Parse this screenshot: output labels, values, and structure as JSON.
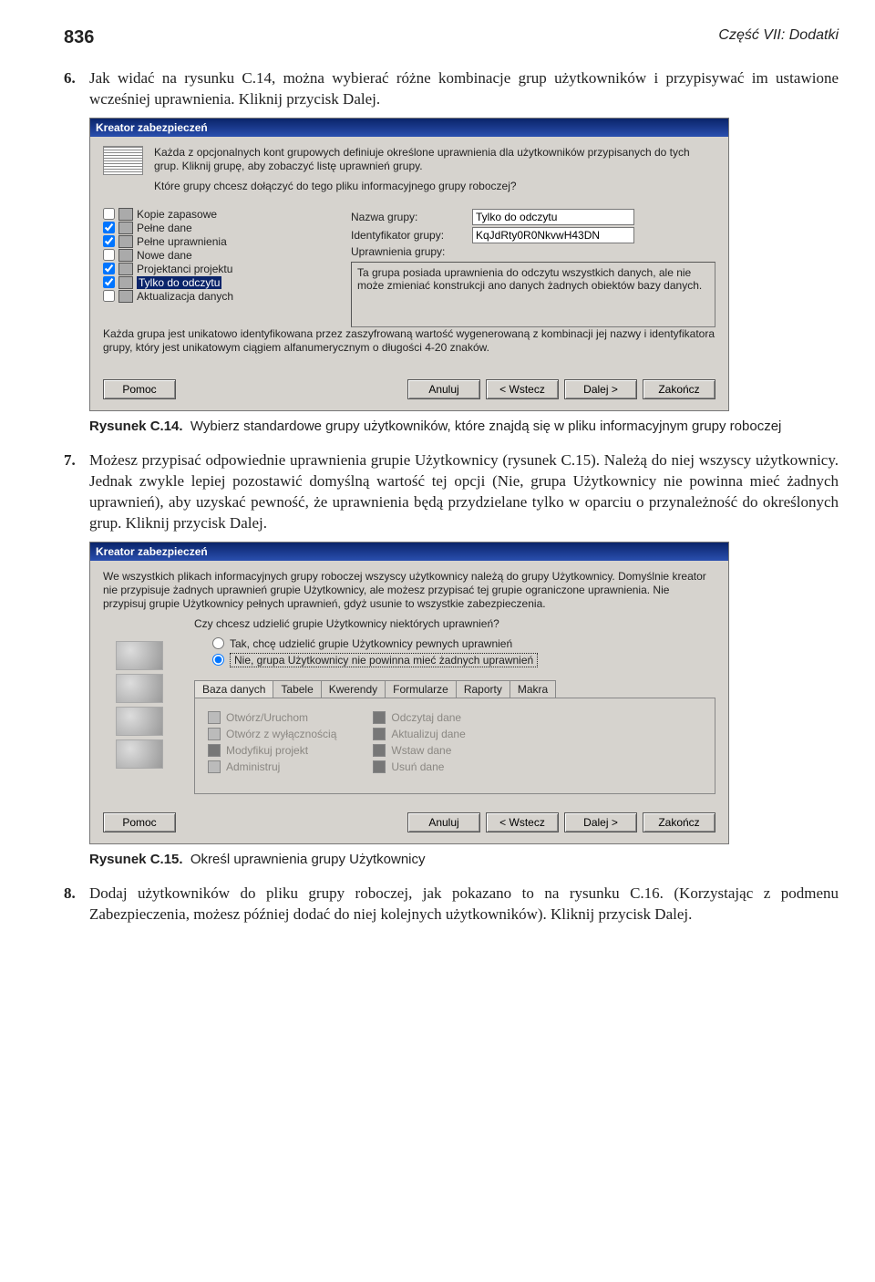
{
  "header": {
    "page_num": "836",
    "section": "Część VII: Dodatki"
  },
  "para6": {
    "num": "6.",
    "text": "Jak widać na rysunku C.14, można wybierać różne kombinacje grup użytkowników i przypisywać im ustawione wcześniej uprawnienia. Kliknij przycisk Dalej."
  },
  "dialog1": {
    "title": "Kreator zabezpieczeń",
    "intro1": "Każda z opcjonalnych kont grupowych definiuje określone uprawnienia dla użytkowników przypisanych do tych grup. Kliknij grupę, aby zobaczyć listę uprawnień grupy.",
    "intro2": "Które grupy chcesz dołączyć do tego pliku informacyjnego grupy roboczej?",
    "groups": [
      {
        "label": "Kopie zapasowe",
        "checked": false
      },
      {
        "label": "Pełne dane",
        "checked": true
      },
      {
        "label": "Pełne uprawnienia",
        "checked": true
      },
      {
        "label": "Nowe dane",
        "checked": false
      },
      {
        "label": "Projektanci projektu",
        "checked": true
      },
      {
        "label": "Tylko do odczytu",
        "checked": true,
        "selected": true
      },
      {
        "label": "Aktualizacja danych",
        "checked": false
      }
    ],
    "field_labels": {
      "name": "Nazwa grupy:",
      "id": "Identyfikator grupy:",
      "perm": "Uprawnienia grupy:"
    },
    "field_values": {
      "name": "Tylko do odczytu",
      "id": "KqJdRty0R0NkvwH43DN"
    },
    "perm_desc": "Ta grupa posiada uprawnienia do odczytu wszystkich danych, ale nie może zmieniać konstrukcji ano danych żadnych obiektów bazy danych.",
    "note": "Każda grupa jest unikatowo identyfikowana przez zaszyfrowaną wartość wygenerowaną z kombinacji jej nazwy i identyfikatora grupy, który jest unikatowym ciągiem alfanumerycznym o długości 4-20 znaków.",
    "buttons": {
      "help": "Pomoc",
      "cancel": "Anuluj",
      "back": "< Wstecz",
      "next": "Dalej >",
      "finish": "Zakończ"
    }
  },
  "caption1": {
    "label": "Rysunek C.14.",
    "text": "Wybierz standardowe grupy użytkowników, które znajdą się w pliku informacyjnym grupy roboczej"
  },
  "para7": {
    "num": "7.",
    "text": "Możesz przypisać odpowiednie uprawnienia grupie Użytkownicy (rysunek C.15). Należą do niej wszyscy użytkownicy. Jednak zwykle lepiej pozostawić domyślną wartość tej opcji (Nie, grupa Użytkownicy nie powinna mieć żadnych uprawnień), aby uzyskać pewność, że uprawnienia będą przydzielane tylko w oparciu o przynależność do określonych grup. Kliknij przycisk Dalej."
  },
  "dialog2": {
    "title": "Kreator zabezpieczeń",
    "intro": "We wszystkich plikach informacyjnych grupy roboczej wszyscy użytkownicy należą do grupy Użytkownicy. Domyślnie kreator nie przypisuje żadnych uprawnień grupie Użytkownicy, ale możesz przypisać tej grupie ograniczone uprawnienia. Nie przypisuj grupie Użytkownicy pełnych uprawnień, gdyż usunie to wszystkie zabezpieczenia.",
    "question": "Czy chcesz udzielić grupie Użytkownicy niektórych uprawnień?",
    "opt_yes": "Tak, chcę udzielić grupie Użytkownicy pewnych uprawnień",
    "opt_no": "Nie, grupa Użytkownicy nie powinna mieć żadnych uprawnień",
    "tabs": [
      "Baza danych",
      "Tabele",
      "Kwerendy",
      "Formularze",
      "Raporty",
      "Makra"
    ],
    "perm_left": [
      "Otwórz/Uruchom",
      "Otwórz z wyłącznością",
      "Modyfikuj projekt",
      "Administruj"
    ],
    "perm_right": [
      "Odczytaj dane",
      "Aktualizuj dane",
      "Wstaw dane",
      "Usuń dane"
    ],
    "buttons": {
      "help": "Pomoc",
      "cancel": "Anuluj",
      "back": "< Wstecz",
      "next": "Dalej >",
      "finish": "Zakończ"
    }
  },
  "caption2": {
    "label": "Rysunek C.15.",
    "text": "Określ uprawnienia grupy Użytkownicy"
  },
  "para8": {
    "num": "8.",
    "text": "Dodaj użytkowników do pliku grupy roboczej, jak pokazano to na rysunku C.16. (Korzystając z podmenu Zabezpieczenia, możesz później dodać do niej kolejnych użytkowników). Kliknij przycisk Dalej."
  }
}
